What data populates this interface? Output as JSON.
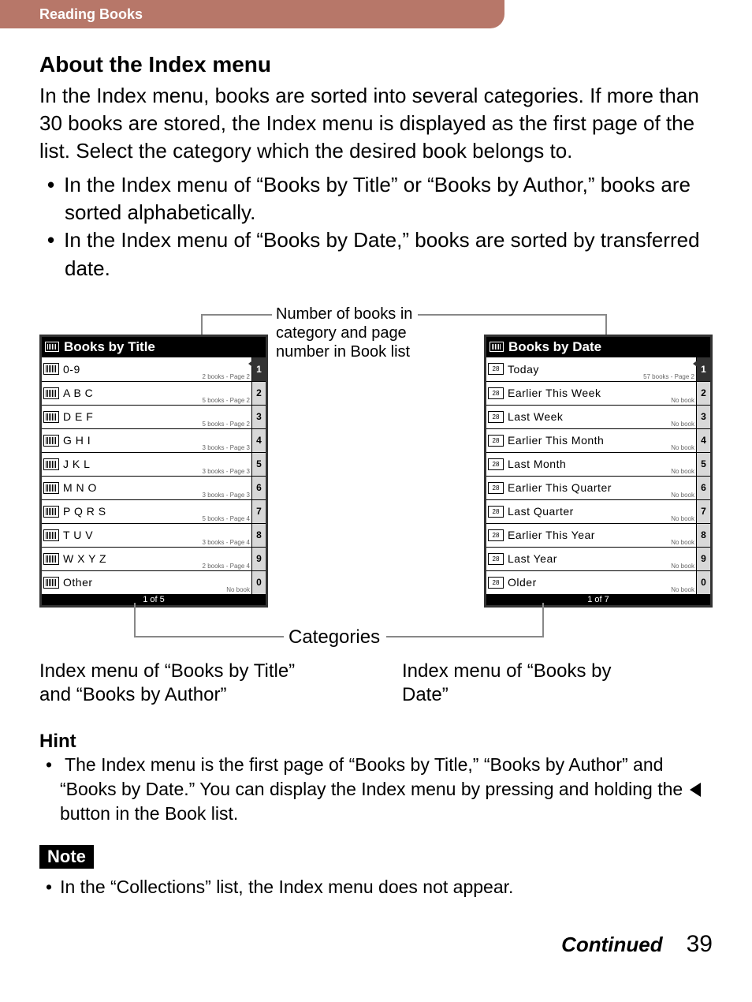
{
  "header": {
    "section": "Reading Books"
  },
  "title": "About the Index menu",
  "intro": "In the Index menu, books are sorted into several categories. If more than 30 books are stored, the Index menu is displayed as the first page of the list. Select the category which the desired book belongs to.",
  "bullets": [
    "In the Index menu of “Books by Title” or “Books by Author,” books are sorted alphabetically.",
    "In the Index menu of “Books by Date,” books are sorted by transferred date."
  ],
  "callouts": {
    "top": "Number of books in category and page number in Book list",
    "categories": "Categories"
  },
  "screens": {
    "left": {
      "title": "Books by Title",
      "rows": [
        {
          "label": "0-9",
          "meta": "2 books - Page 2"
        },
        {
          "label": "A B C",
          "meta": "5 books - Page 2"
        },
        {
          "label": "D E F",
          "meta": "5 books - Page 2"
        },
        {
          "label": "G H I",
          "meta": "3 books - Page 3"
        },
        {
          "label": "J K L",
          "meta": "3 books - Page 3"
        },
        {
          "label": "M N O",
          "meta": "3 books - Page 3"
        },
        {
          "label": "P Q R S",
          "meta": "5 books - Page 4"
        },
        {
          "label": "T U V",
          "meta": "3 books - Page 4"
        },
        {
          "label": "W X Y Z",
          "meta": "2 books - Page 4"
        },
        {
          "label": "Other",
          "meta": "No book"
        }
      ],
      "nums": [
        "1",
        "2",
        "3",
        "4",
        "5",
        "6",
        "7",
        "8",
        "9",
        "0"
      ],
      "footer": "1 of 5",
      "caption": "Index menu of “Books by Title” and “Books by Author”"
    },
    "right": {
      "title": "Books by Date",
      "rows": [
        {
          "label": "Today",
          "meta": "57 books - Page 2"
        },
        {
          "label": "Earlier This Week",
          "meta": "No book"
        },
        {
          "label": "Last Week",
          "meta": "No book"
        },
        {
          "label": "Earlier This Month",
          "meta": "No book"
        },
        {
          "label": "Last Month",
          "meta": "No book"
        },
        {
          "label": "Earlier This Quarter",
          "meta": "No book"
        },
        {
          "label": "Last Quarter",
          "meta": "No book"
        },
        {
          "label": "Earlier This Year",
          "meta": "No book"
        },
        {
          "label": "Last Year",
          "meta": "No book"
        },
        {
          "label": "Older",
          "meta": "No book"
        }
      ],
      "nums": [
        "1",
        "2",
        "3",
        "4",
        "5",
        "6",
        "7",
        "8",
        "9",
        "0"
      ],
      "footer": "1 of 7",
      "caption": "Index menu of “Books by Date”"
    }
  },
  "hint": {
    "title": "Hint",
    "text_a": "The Index menu is the first page of “Books by Title,” “Books by Author” and “Books by Date.” You can display the Index menu by pressing and holding the ",
    "text_b": " button in the Book list."
  },
  "note": {
    "badge": "Note",
    "text": "In the “Collections” list, the Index menu does not appear."
  },
  "footer": {
    "continued": "Continued",
    "page": "39"
  }
}
